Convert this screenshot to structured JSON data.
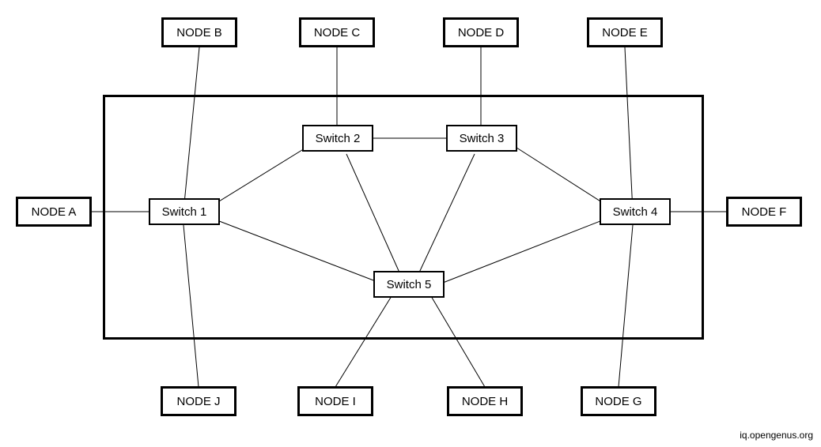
{
  "nodes": {
    "A": "NODE A",
    "B": "NODE B",
    "C": "NODE C",
    "D": "NODE D",
    "E": "NODE E",
    "F": "NODE F",
    "G": "NODE G",
    "H": "NODE H",
    "I": "NODE I",
    "J": "NODE J"
  },
  "switches": {
    "1": "Switch 1",
    "2": "Switch 2",
    "3": "Switch 3",
    "4": "Switch 4",
    "5": "Switch 5"
  },
  "attribution": "iq.opengenus.org",
  "diagram": {
    "type": "network-topology",
    "description": "Switched network: 10 peripheral nodes connect through 5 interconnected switches inside a central switching fabric.",
    "edges": [
      [
        "NODE A",
        "Switch 1"
      ],
      [
        "NODE B",
        "Switch 1"
      ],
      [
        "NODE C",
        "Switch 2"
      ],
      [
        "NODE D",
        "Switch 3"
      ],
      [
        "NODE E",
        "Switch 4"
      ],
      [
        "NODE F",
        "Switch 4"
      ],
      [
        "NODE G",
        "Switch 4"
      ],
      [
        "NODE H",
        "Switch 5"
      ],
      [
        "NODE I",
        "Switch 5"
      ],
      [
        "NODE J",
        "Switch 1"
      ],
      [
        "Switch 1",
        "Switch 2"
      ],
      [
        "Switch 1",
        "Switch 5"
      ],
      [
        "Switch 2",
        "Switch 3"
      ],
      [
        "Switch 2",
        "Switch 5"
      ],
      [
        "Switch 3",
        "Switch 4"
      ],
      [
        "Switch 3",
        "Switch 5"
      ],
      [
        "Switch 4",
        "Switch 5"
      ]
    ]
  }
}
